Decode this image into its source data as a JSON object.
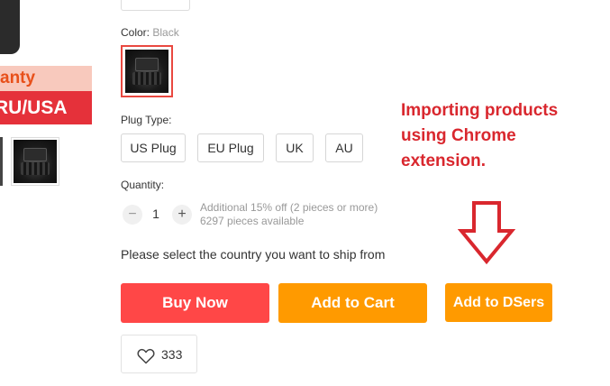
{
  "gallery": {
    "promo_line1": "anty",
    "promo_line2": "RU/USA"
  },
  "product": {
    "color_label": "Color: ",
    "color_value": "Black",
    "plug_type_label": "Plug Type:",
    "plug_options": [
      "US Plug",
      "EU Plug",
      "UK",
      "AU"
    ],
    "quantity_label": "Quantity:",
    "quantity_value": "1",
    "minus_symbol": "−",
    "plus_symbol": "+",
    "discount_text": "Additional 15% off (2 pieces or more)",
    "available_text": "6297 pieces available",
    "ship_prompt": "Please select the country you want to ship from"
  },
  "actions": {
    "buy_now": "Buy Now",
    "add_to_cart": "Add to Cart",
    "add_to_dsers": "Add to DSers",
    "wishlist_count": "333"
  },
  "annotation": {
    "line1": "Importing products",
    "line2": "using Chrome",
    "line3": "extension."
  },
  "colors": {
    "buy_now": "#ff4747",
    "add_to_cart": "#ff9a00",
    "annotation": "#d9272e",
    "selected_border": "#e94840"
  },
  "icons": {
    "wishlist": "heart-icon",
    "annotation_arrow": "down-arrow-icon"
  }
}
